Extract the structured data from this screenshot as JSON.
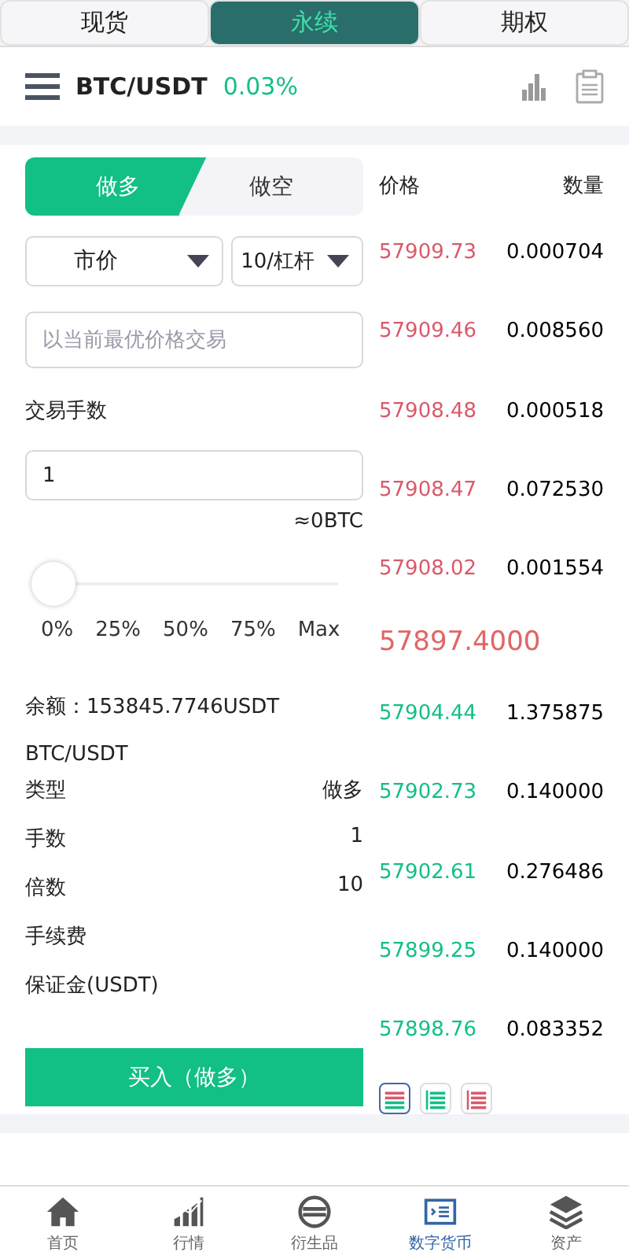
{
  "market_tabs": [
    {
      "label": "现货",
      "selected": false
    },
    {
      "label": "永续",
      "selected": true
    },
    {
      "label": "期权",
      "selected": false
    }
  ],
  "header": {
    "pair": "BTC/USDT",
    "change": "0.03%"
  },
  "order_form": {
    "sides": [
      {
        "label": "做多",
        "selected": true
      },
      {
        "label": "做空",
        "selected": false
      }
    ],
    "order_type": "市价",
    "leverage": "10/杠杆",
    "price_placeholder": "以当前最优价格交易",
    "quantity_label": "交易手数",
    "quantity": "1",
    "estimate": "≈0BTC",
    "slider": {
      "level": 0
    },
    "percents": [
      "0%",
      "25%",
      "50%",
      "75%",
      "Max"
    ],
    "balance": "余额：153845.7746USDT",
    "pair": "BTC/USDT",
    "summary": [
      {
        "label": "类型",
        "value": "做多"
      },
      {
        "label": "手数",
        "value": "1"
      },
      {
        "label": "倍数",
        "value": "10"
      },
      {
        "label": "手续费"
      },
      {
        "label": "保证金(USDT)"
      }
    ],
    "submit": "买入（做多）"
  },
  "order_book": {
    "columns": [
      "价格",
      "数量"
    ],
    "asks": [
      {
        "price": "57909.73",
        "amount": "0.000704"
      },
      {
        "price": "57909.46",
        "amount": "0.008560"
      },
      {
        "price": "57908.48",
        "amount": "0.000518"
      },
      {
        "price": "57908.47",
        "amount": "0.072530"
      },
      {
        "price": "57908.02",
        "amount": "0.001554"
      }
    ],
    "last_price": "57897.4000",
    "bids": [
      {
        "price": "57904.44",
        "amount": "1.375875"
      },
      {
        "price": "57902.73",
        "amount": "0.140000"
      },
      {
        "price": "57902.61",
        "amount": "0.276486"
      },
      {
        "price": "57899.25",
        "amount": "0.140000"
      },
      {
        "price": "57898.76",
        "amount": "0.083352"
      }
    ],
    "depth_modes": [
      {
        "kind": "both",
        "selected": true
      },
      {
        "kind": "bids",
        "selected": false
      },
      {
        "kind": "asks",
        "selected": false
      }
    ]
  },
  "bottom_nav": [
    {
      "label": "首页",
      "selected": false
    },
    {
      "label": "行情",
      "selected": false
    },
    {
      "label": "衍生品",
      "selected": false
    },
    {
      "label": "数字货币",
      "selected": true
    },
    {
      "label": "资产",
      "selected": false
    }
  ]
}
